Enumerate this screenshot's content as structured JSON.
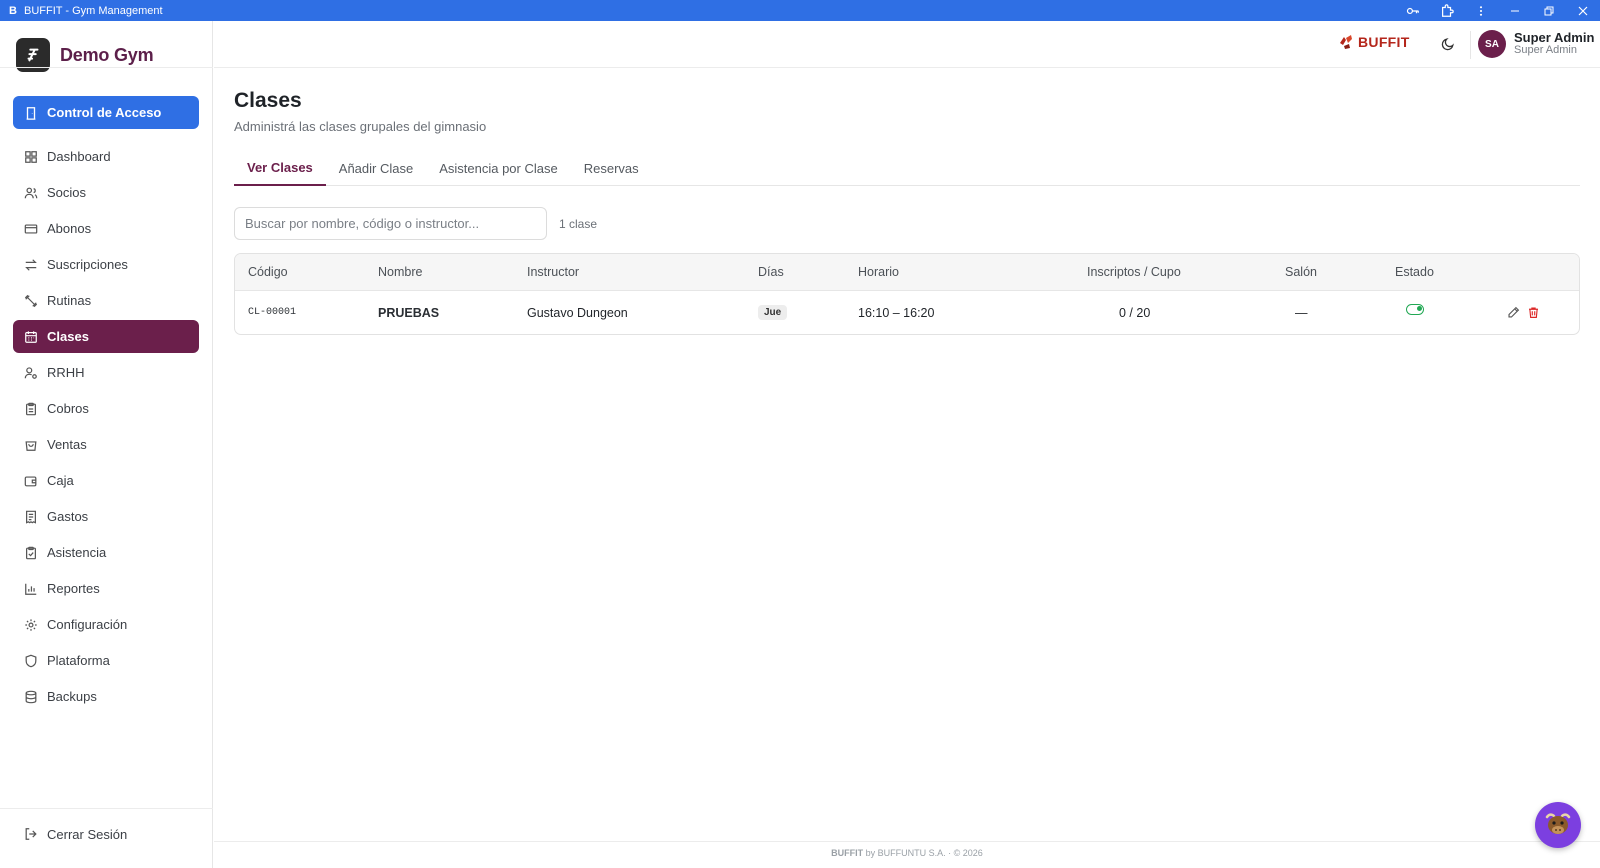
{
  "window": {
    "app_glyph": "B",
    "title": "BUFFIT - Gym Management"
  },
  "sidebar": {
    "brand_name": "Demo Gym",
    "access_button": "Control de Acceso",
    "items": [
      {
        "label": "Dashboard",
        "icon": "grid-icon"
      },
      {
        "label": "Socios",
        "icon": "users-icon"
      },
      {
        "label": "Abonos",
        "icon": "card-icon"
      },
      {
        "label": "Suscripciones",
        "icon": "arrows-icon"
      },
      {
        "label": "Rutinas",
        "icon": "dumbbell-icon"
      },
      {
        "label": "Clases",
        "icon": "calendar-icon",
        "active": true
      },
      {
        "label": "RRHH",
        "icon": "user-cog-icon"
      },
      {
        "label": "Cobros",
        "icon": "clipboard-icon"
      },
      {
        "label": "Ventas",
        "icon": "bag-icon"
      },
      {
        "label": "Caja",
        "icon": "wallet-icon"
      },
      {
        "label": "Gastos",
        "icon": "receipt-icon"
      },
      {
        "label": "Asistencia",
        "icon": "clipboard-check-icon"
      },
      {
        "label": "Reportes",
        "icon": "bar-chart-icon"
      },
      {
        "label": "Configuración",
        "icon": "gear-icon"
      },
      {
        "label": "Plataforma",
        "icon": "shield-icon"
      },
      {
        "label": "Backups",
        "icon": "database-icon"
      }
    ],
    "logout_label": "Cerrar Sesión"
  },
  "header": {
    "logo_word": "BUFFIT",
    "avatar_initials": "SA",
    "user_name": "Super Admin",
    "user_role": "Super Admin"
  },
  "page": {
    "title": "Clases",
    "subtitle": "Administrá las clases grupales del gimnasio",
    "tabs": [
      "Ver Clases",
      "Añadir Clase",
      "Asistencia por Clase",
      "Reservas"
    ],
    "active_tab": 0,
    "search": {
      "placeholder": "Buscar por nombre, código o instructor...",
      "value": ""
    },
    "count_label": "1 clase"
  },
  "table": {
    "headers": {
      "code": "Código",
      "name": "Nombre",
      "instructor": "Instructor",
      "days": "Días",
      "schedule": "Horario",
      "enrolled": "Inscriptos / Cupo",
      "room": "Salón",
      "status": "Estado"
    },
    "rows": [
      {
        "code": "CL-00001",
        "name": "PRUEBAS",
        "instructor": "Gustavo Dungeon",
        "days": "Jue",
        "schedule": "16:10 – 16:20",
        "enrolled": "0 / 20",
        "room": "—",
        "status": "active"
      }
    ]
  },
  "footer": {
    "brand": "BUFFIT",
    "text": " by BUFFUNTU S.A. · © 2026"
  },
  "colors": {
    "accent_blue": "#2f6fe4",
    "brand_plum": "#6b1f4b",
    "status_green": "#22a854",
    "danger_red": "#dc2626",
    "mascot_purple": "#7c3fe0"
  }
}
